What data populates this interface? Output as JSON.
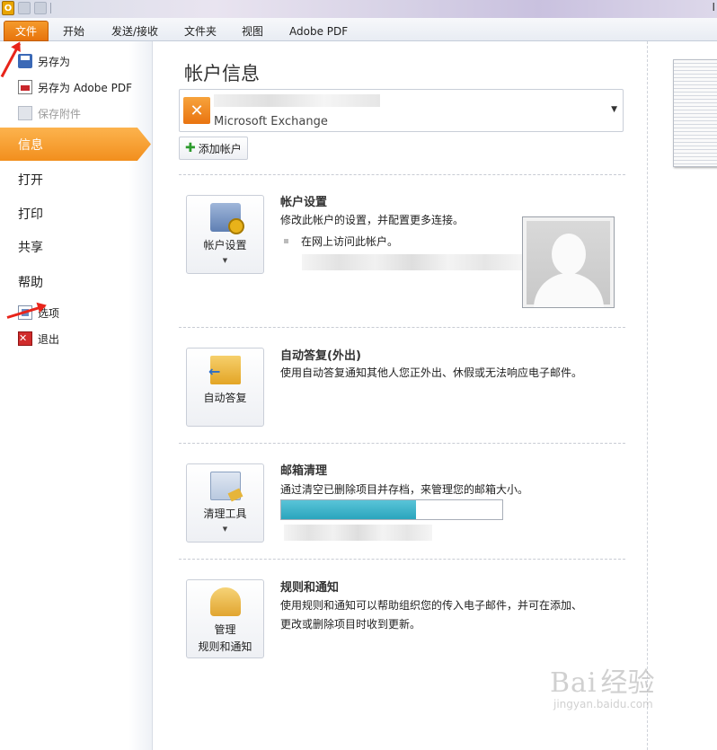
{
  "title_bar": {
    "app_icon": "O",
    "right_text": "I"
  },
  "ribbon_tabs": [
    {
      "label": "文件"
    },
    {
      "label": "开始"
    },
    {
      "label": "发送/接收"
    },
    {
      "label": "文件夹"
    },
    {
      "label": "视图"
    },
    {
      "label": "Adobe PDF"
    }
  ],
  "backstage": {
    "commands_top": [
      {
        "label": "另存为",
        "icon": "save-as-icon"
      },
      {
        "label": "另存为 Adobe PDF",
        "icon": "pdf-icon"
      },
      {
        "label": "保存附件",
        "icon": "save-attachments-icon",
        "disabled": true
      }
    ],
    "tabs": [
      {
        "label": "信息",
        "active": true
      },
      {
        "label": "打开"
      },
      {
        "label": "打印"
      },
      {
        "label": "共享"
      },
      {
        "label": "帮助"
      }
    ],
    "commands_bottom": [
      {
        "label": "选项",
        "icon": "options-icon"
      },
      {
        "label": "退出",
        "icon": "exit-icon",
        "icon_glyph": "✕"
      }
    ]
  },
  "main": {
    "title": "帐户信息",
    "account_type": "Microsoft Exchange",
    "add_account_label": "添加帐户",
    "sections": [
      {
        "button_label": "帐户设置",
        "title": "帐户设置",
        "desc": "修改此帐户的设置，并配置更多连接。",
        "link": "在网上访问此帐户。"
      },
      {
        "button_label": "自动答复",
        "title": "自动答复(外出)",
        "desc": "使用自动答复通知其他人您正外出、休假或无法响应电子邮件。"
      },
      {
        "button_label": "清理工具",
        "title": "邮箱清理",
        "desc": "通过清空已删除项目并存档，来管理您的邮箱大小。",
        "mailbox_fill_fraction": 0.61
      },
      {
        "button_label_line1": "管理",
        "button_label_line2": "规则和通知",
        "title": "规则和通知",
        "desc_line1": "使用规则和通知可以帮助组织您的传入电子邮件，并可在添加、",
        "desc_line2": "更改或删除项目时收到更新。"
      }
    ]
  },
  "watermark": {
    "brand": "Bai",
    "brand_cn": "经验",
    "url": "jingyan.baidu.com"
  },
  "colors": {
    "accent_orange": "#f28f1d",
    "progress_teal": "#2ba5bd",
    "annotation_red": "#e8241a"
  }
}
